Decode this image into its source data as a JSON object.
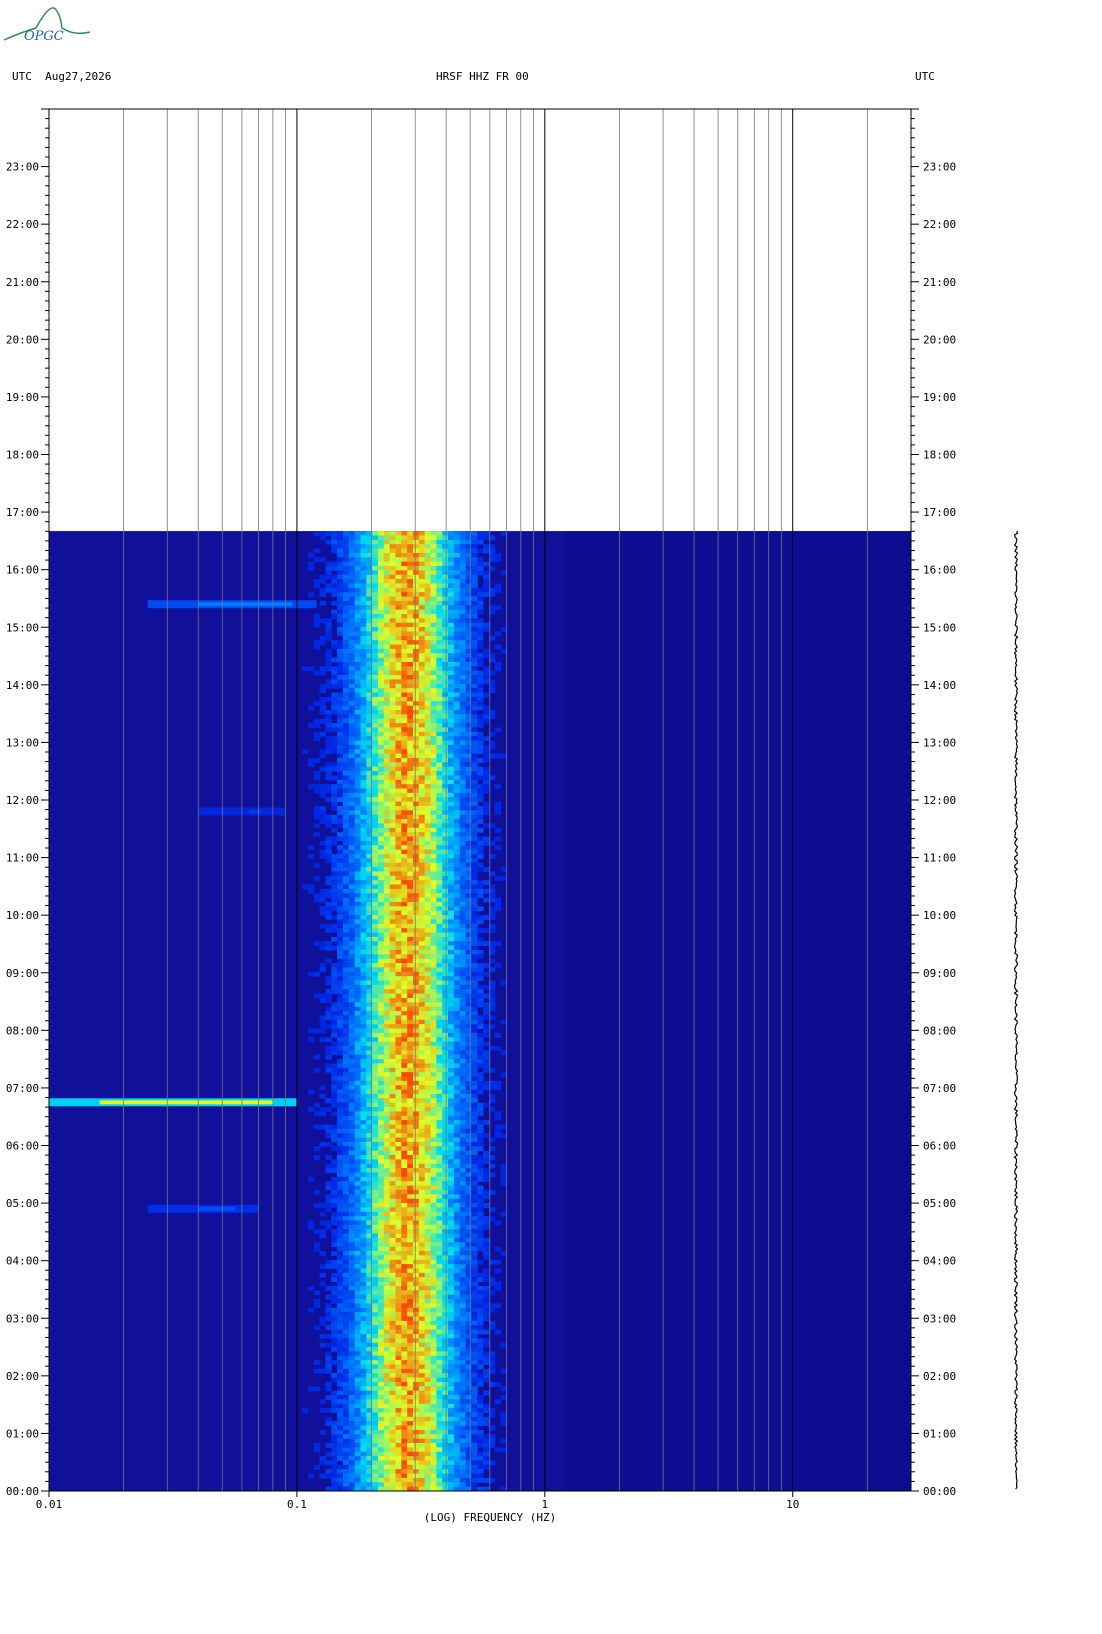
{
  "header": {
    "logo_text": "OPGC",
    "left": "UTC  Aug27,2026",
    "center": "HRSF HHZ FR 00",
    "right": "UTC"
  },
  "chart_data": {
    "type": "heatmap",
    "title": "HRSF HHZ FR 00",
    "date": "Aug27,2026",
    "xlabel": "(LOG) FREQUENCY (HZ)",
    "xscale": "log",
    "xlim": [
      0.01,
      30
    ],
    "x_ticks": [
      "0.01",
      "0.1",
      "1",
      "10"
    ],
    "ylabel_left": "UTC",
    "ylabel_right": "UTC",
    "ylim_hours": [
      0,
      24
    ],
    "y_ticks": [
      "00:00",
      "01:00",
      "02:00",
      "03:00",
      "04:00",
      "05:00",
      "06:00",
      "07:00",
      "08:00",
      "09:00",
      "10:00",
      "11:00",
      "12:00",
      "13:00",
      "14:00",
      "15:00",
      "16:00",
      "17:00",
      "18:00",
      "19:00",
      "20:00",
      "21:00",
      "22:00",
      "23:00"
    ],
    "data_end_hour": 16.67,
    "colormap": [
      "#00008b",
      "#0000ff",
      "#0080ff",
      "#00ffff",
      "#ffff00",
      "#ff0000"
    ],
    "background_color": "#10109a",
    "microseism_band_hz": [
      0.15,
      0.45
    ],
    "microseism_peak_hz": 0.28,
    "events": [
      {
        "hour": 15.4,
        "fmin": 0.025,
        "fmax": 0.12,
        "level": 0.45
      },
      {
        "hour": 11.8,
        "fmin": 0.04,
        "fmax": 0.09,
        "level": 0.3
      },
      {
        "hour": 6.75,
        "fmin": 0.01,
        "fmax": 0.1,
        "level": 0.8
      },
      {
        "hour": 4.9,
        "fmin": 0.025,
        "fmax": 0.07,
        "level": 0.35
      }
    ]
  }
}
